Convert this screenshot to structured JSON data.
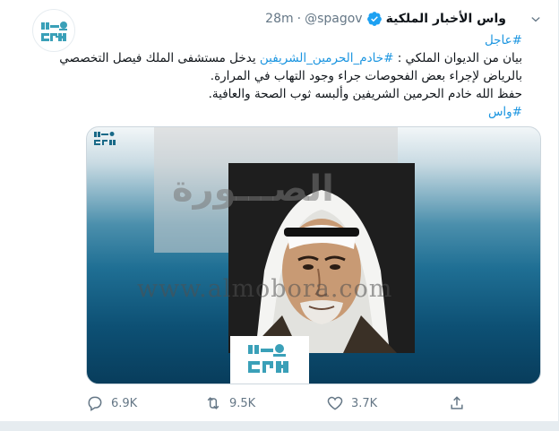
{
  "tweet": {
    "display_name": "واس الأخبار الملكية",
    "handle": "@spagov",
    "separator": "·",
    "time": "28m",
    "lines": [
      "#عاجل",
      "بيان من الديوان الملكي : #خادم_الحرمين_الشريفين يدخل مستشفى الملك فيصل التخصصي",
      "بالرياض لإجراء بعض الفحوصات جراء وجود التهاب في المرارة.",
      "حفظ الله خادم الحرمين الشريفين وألبسه ثوب الصحة والعافية.",
      "#واس"
    ],
    "line2_prefix": "بيان من الديوان الملكي : ",
    "line2_hashtag": "#خادم_الحرمين_الشريفين",
    "line2_suffix": " يدخل مستشفى الملك فيصل التخصصي"
  },
  "media": {
    "watermark_url": "www.almobora.com",
    "watermark_ar": "الصـــورة",
    "logo_text_top": "واس",
    "logo_text_bottom": "SPA"
  },
  "actions": {
    "reply_count": "6.9K",
    "retweet_count": "9.5K",
    "like_count": "3.7K"
  },
  "colors": {
    "link": "#1b95e0",
    "muted": "#657786",
    "verified": "#1da1f2",
    "spa_teal": "#3aa0b8"
  }
}
